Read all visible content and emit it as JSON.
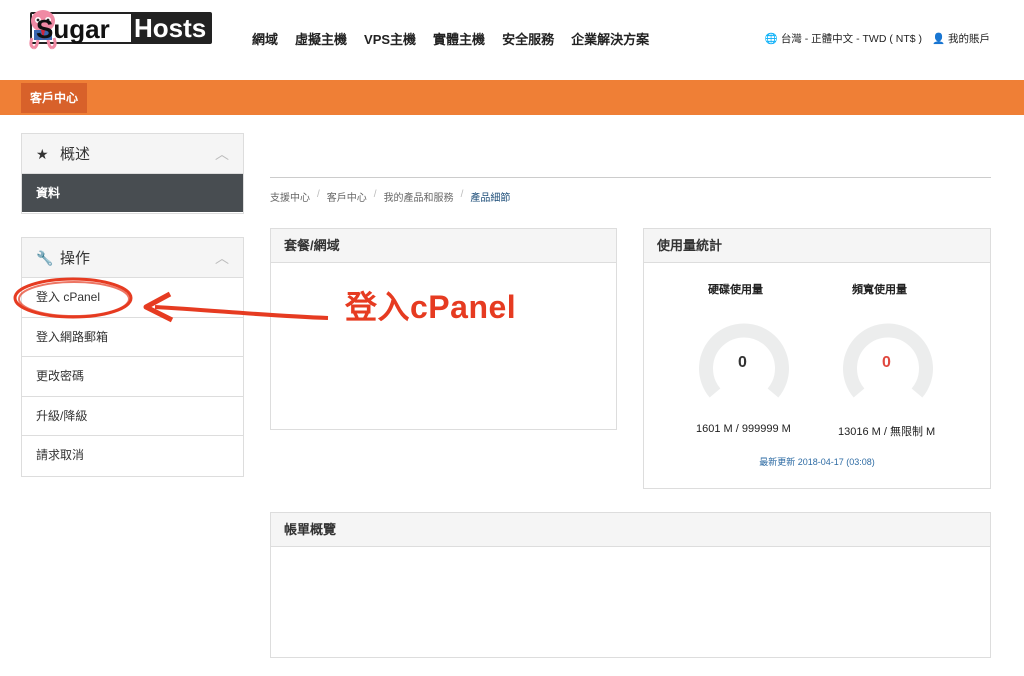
{
  "brand": {
    "logo_part1": "Sugar",
    "logo_part2": "Hosts"
  },
  "nav": [
    "網域",
    "虛擬主機",
    "VPS主機",
    "實體主機",
    "安全服務",
    "企業解決方案"
  ],
  "region": {
    "locale": "台灣 - 正體中文 - TWD ( NT$ )",
    "account": "我的賬戶"
  },
  "section_tab": "客戶中心",
  "sidebar": {
    "overview": {
      "title": "概述",
      "active_item": "資料"
    },
    "actions": {
      "title": "操作",
      "items": [
        "登入 cPanel",
        "登入網路郵箱",
        "更改密碼",
        "升級/降級",
        "請求取消"
      ]
    }
  },
  "breadcrumb": [
    "支援中心",
    "客戶中心",
    "我的產品和服務",
    "產品細節"
  ],
  "package_panel": {
    "title": "套餐/網域"
  },
  "usage_panel": {
    "title": "使用量統計",
    "disk": {
      "label": "硬碟使用量",
      "value": "0",
      "caption": "1601 M / 999999 M",
      "color": "#333333"
    },
    "bandwidth": {
      "label": "頻寬使用量",
      "value": "0",
      "caption": "13016 M / 無限制 M",
      "color": "#e0483f"
    },
    "updated": "最新更新 2018-04-17 (03:08)"
  },
  "billing_panel": {
    "title": "帳單概覽"
  },
  "annotation": {
    "text": "登入cPanel",
    "color": "#e63b21"
  }
}
